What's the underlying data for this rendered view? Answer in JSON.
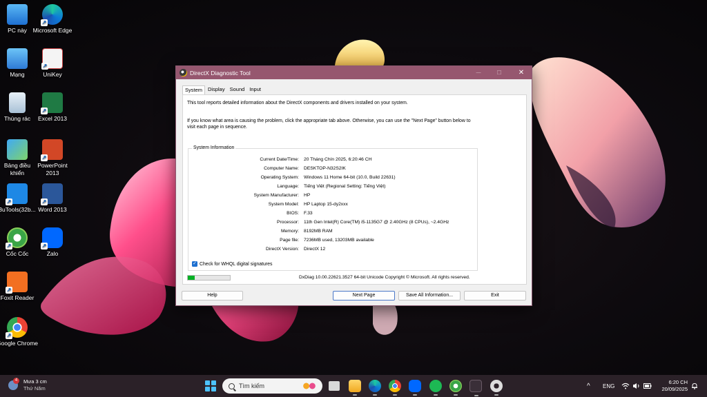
{
  "desktop": {
    "icons": [
      {
        "label": "PC này",
        "icon": "computer-icon"
      },
      {
        "label": "Microsoft Edge",
        "icon": "edge-icon"
      },
      {
        "label": "Mạng",
        "icon": "network-icon"
      },
      {
        "label": "UniKey",
        "icon": "unikey-icon"
      },
      {
        "label": "Thùng rác",
        "icon": "recycle-bin-icon"
      },
      {
        "label": "Excel 2013",
        "icon": "excel-icon"
      },
      {
        "label": "Bảng điều khiển",
        "icon": "control-panel-icon"
      },
      {
        "label": "PowerPoint 2013",
        "icon": "powerpoint-icon"
      },
      {
        "label": "3uTools(32b...",
        "icon": "3utools-icon"
      },
      {
        "label": "Word 2013",
        "icon": "word-icon"
      },
      {
        "label": "Cốc Cốc",
        "icon": "coccoc-icon"
      },
      {
        "label": "Zalo",
        "icon": "zalo-icon"
      },
      {
        "label": "Foxit Reader",
        "icon": "foxit-icon"
      },
      {
        "label": "Google Chrome",
        "icon": "chrome-icon"
      }
    ]
  },
  "dialog": {
    "title": "DirectX Diagnostic Tool",
    "minimize": "—",
    "maximize": "☐",
    "close": "✕",
    "tabs": [
      "System",
      "Display",
      "Sound",
      "Input"
    ],
    "active_tab": "System",
    "intro_1": "This tool reports detailed information about the DirectX components and drivers installed on your system.",
    "intro_2a": "If you know what area is causing the problem, click the appropriate tab above.  Otherwise, you can use the \"Next Page\" button below to",
    "intro_2b": "visit each page in sequence.",
    "group_title": "System Information",
    "rows": [
      {
        "label": "Current Date/Time:",
        "value": "20 Tháng Chín 2025, 6:20:46 CH"
      },
      {
        "label": "Computer Name:",
        "value": "DESKTOP-N32S2IK"
      },
      {
        "label": "Operating System:",
        "value": "Windows 11 Home 64-bit (10.0, Build 22631)"
      },
      {
        "label": "Language:",
        "value": "Tiếng Việt (Regional Setting: Tiếng Việt)"
      },
      {
        "label": "System Manufacturer:",
        "value": "HP"
      },
      {
        "label": "System Model:",
        "value": "HP Laptop 15-dy2xxx"
      },
      {
        "label": "BIOS:",
        "value": "F.33"
      },
      {
        "label": "Processor:",
        "value": "11th Gen Intel(R) Core(TM) i5-1135G7 @ 2.40GHz (8 CPUs), ~2.4GHz"
      },
      {
        "label": "Memory:",
        "value": "8192MB RAM"
      },
      {
        "label": "Page file:",
        "value": "7236MB used, 13203MB available"
      },
      {
        "label": "DirectX Version:",
        "value": "DirectX 12"
      }
    ],
    "whql_label": "Check for WHQL digital signatures",
    "whql_checked": true,
    "progress": 0.17,
    "footer_note": "DxDiag 10.00.22621.3527 64-bit Unicode  Copyright © Microsoft. All rights reserved.",
    "buttons": {
      "help": "Help",
      "next": "Next Page",
      "save": "Save All Information...",
      "exit": "Exit"
    }
  },
  "taskbar": {
    "weather_title": "Mưa 3 cm",
    "weather_sub": "Thứ Năm",
    "weather_badge": "4",
    "search_placeholder": "Tìm kiếm",
    "language": "ENG",
    "time": "6:20 CH",
    "date": "20/09/2025",
    "tray_chevron": "^",
    "accent": "#4cc2ff"
  }
}
